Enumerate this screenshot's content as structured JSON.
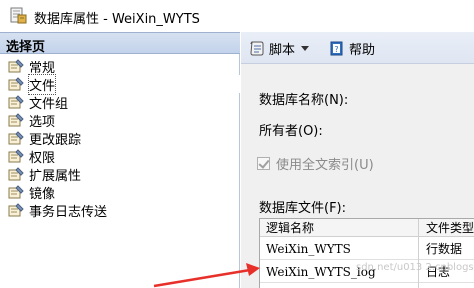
{
  "window": {
    "title": "数据库属性 - WeiXin_WYTS",
    "app_icon": "database-properties-icon"
  },
  "left_pane": {
    "header": "选择页",
    "items": [
      {
        "label": "常规",
        "icon": "page-wrench-icon"
      },
      {
        "label": "文件",
        "icon": "page-wrench-icon"
      },
      {
        "label": "文件组",
        "icon": "page-wrench-icon"
      },
      {
        "label": "选项",
        "icon": "page-wrench-icon"
      },
      {
        "label": "更改跟踪",
        "icon": "page-wrench-icon"
      },
      {
        "label": "权限",
        "icon": "page-wrench-icon"
      },
      {
        "label": "扩展属性",
        "icon": "page-wrench-icon"
      },
      {
        "label": "镜像",
        "icon": "page-wrench-icon"
      },
      {
        "label": "事务日志传送",
        "icon": "page-wrench-icon"
      }
    ],
    "selected_index": 1
  },
  "toolbar": {
    "script_label": "脚本",
    "help_label": "帮助"
  },
  "form": {
    "db_name_label": "数据库名称(N):",
    "owner_label": "所有者(O):",
    "fulltext_label": "使用全文索引(U)",
    "fulltext_checked": true,
    "db_files_label": "数据库文件(F):"
  },
  "files_grid": {
    "columns": [
      "逻辑名称",
      "文件类型"
    ],
    "rows": [
      {
        "logical_name": "WeiXin_WYTS",
        "file_type": "行数据"
      },
      {
        "logical_name": "WeiXin_WYTS_log",
        "file_type": "日志"
      }
    ]
  },
  "annotation": {
    "arrow_color": "#e8302a"
  },
  "watermark": "sdn.net/u013  2.cnblogs"
}
